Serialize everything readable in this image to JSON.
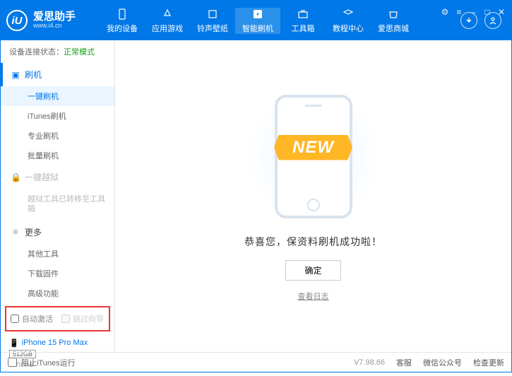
{
  "app": {
    "name": "爱思助手",
    "url": "www.i4.cn",
    "logo": "iU"
  },
  "nav": {
    "items": [
      {
        "label": "我的设备",
        "icon": "device"
      },
      {
        "label": "应用游戏",
        "icon": "apps"
      },
      {
        "label": "铃声壁纸",
        "icon": "ringtone"
      },
      {
        "label": "智能刷机",
        "icon": "flash",
        "active": true
      },
      {
        "label": "工具箱",
        "icon": "tools"
      },
      {
        "label": "教程中心",
        "icon": "tutorial"
      },
      {
        "label": "爱思商城",
        "icon": "shop"
      }
    ]
  },
  "window": {
    "controls": [
      "settings",
      "menu",
      "min",
      "max",
      "close"
    ]
  },
  "connection": {
    "label": "设备连接状态：",
    "value": "正常模式"
  },
  "sidebar": {
    "flash": {
      "title": "刷机",
      "items": [
        {
          "label": "一键刷机",
          "active": true
        },
        {
          "label": "iTunes刷机"
        },
        {
          "label": "专业刷机"
        },
        {
          "label": "批量刷机"
        }
      ]
    },
    "jailbreak": {
      "title": "一键越狱",
      "disabled_note": "越狱工具已转移至工具箱"
    },
    "more": {
      "title": "更多",
      "items": [
        {
          "label": "其他工具"
        },
        {
          "label": "下载固件"
        },
        {
          "label": "高级功能"
        }
      ]
    }
  },
  "checkboxes": {
    "auto_activate": "自动激活",
    "skip_guide": "跳过向导"
  },
  "device": {
    "name": "iPhone 15 Pro Max",
    "capacity": "512GB",
    "model": "iPhone"
  },
  "main": {
    "banner": "NEW",
    "success": "恭喜您，保资料刷机成功啦！",
    "ok": "确定",
    "log": "查看日志"
  },
  "status": {
    "block_itunes": "阻止iTunes运行",
    "version": "V7.98.66",
    "links": [
      "客服",
      "微信公众号",
      "检查更新"
    ]
  }
}
